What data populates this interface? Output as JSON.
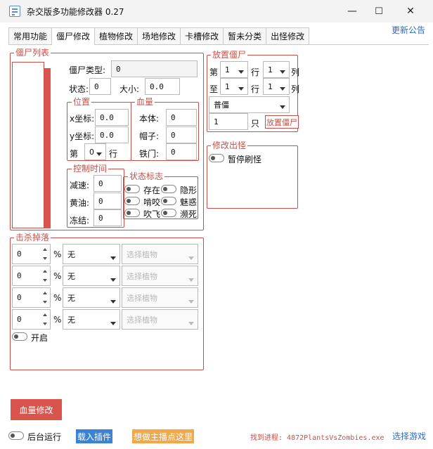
{
  "window": {
    "title": "杂交版多功能修改器  0.27",
    "min": "—",
    "max": "☐",
    "close": "✕"
  },
  "tabs": [
    "常用功能",
    "僵尸修改",
    "植物修改",
    "场地修改",
    "卡槽修改",
    "暂未分类",
    "出怪修改"
  ],
  "active_tab": 1,
  "update_link": "更新公告",
  "zombie_list": {
    "title": "僵尸列表"
  },
  "zombie_type": {
    "label": "僵尸类型:",
    "value": "0"
  },
  "state": {
    "label": "状态:",
    "value": "0"
  },
  "size": {
    "label": "大小:",
    "value": "0.0"
  },
  "position": {
    "title": "位置",
    "x_label": "x坐标:",
    "x_value": "0.0",
    "y_label": "y坐标:",
    "y_value": "0.0",
    "row_prefix": "第",
    "row_value": "0",
    "row_suffix": "行"
  },
  "health": {
    "title": "血量",
    "body_label": "本体:",
    "body_value": "0",
    "hat_label": "帽子:",
    "hat_value": "0",
    "iron_label": "铁门:",
    "iron_value": "0"
  },
  "control_time": {
    "title": "控制时间",
    "slow_label": "减速:",
    "slow_value": "0",
    "butter_label": "黄油:",
    "butter_value": "0",
    "freeze_label": "冻结:",
    "freeze_value": "0"
  },
  "status_flags": {
    "title": "状态标志",
    "exist": "存在",
    "invisible": "隐形",
    "bite": "啃咬",
    "charm": "魅惑",
    "blown": "吹飞",
    "dying": "濒死"
  },
  "place_zombie": {
    "title": "放置僵尸",
    "row_prefix_1": "第",
    "row_prefix_2": "至",
    "row_label": "行",
    "col_label": "列",
    "from_row": "1",
    "from_col": "1",
    "to_row": "1",
    "to_col": "1",
    "type_value": "普僵",
    "count_value": "1",
    "count_unit": "只",
    "button": "放置僵尸"
  },
  "spawn_mod": {
    "title": "修改出怪",
    "pause_label": "暂停刷怪"
  },
  "kill_drop": {
    "title": "击杀掉落",
    "percent": "%",
    "rows": [
      {
        "value": "0",
        "item": "无",
        "plant_placeholder": "选择植物"
      },
      {
        "value": "0",
        "item": "无",
        "plant_placeholder": "选择植物"
      },
      {
        "value": "0",
        "item": "无",
        "plant_placeholder": "选择植物"
      },
      {
        "value": "0",
        "item": "无",
        "plant_placeholder": "选择植物"
      }
    ],
    "enable_label": "开启"
  },
  "health_mod_button": "血量修改",
  "footer": {
    "bg_run": "后台运行",
    "load_plugin": "载入插件",
    "streamer": "想做主播点这里",
    "process_status": "找到进程: 4872PlantsVsZombies.exe",
    "select_game": "选择游戏"
  },
  "colors": {
    "accent": "#c8504a",
    "blue": "#3b82d4",
    "orange": "#f0a848",
    "link": "#2b6cc4"
  }
}
